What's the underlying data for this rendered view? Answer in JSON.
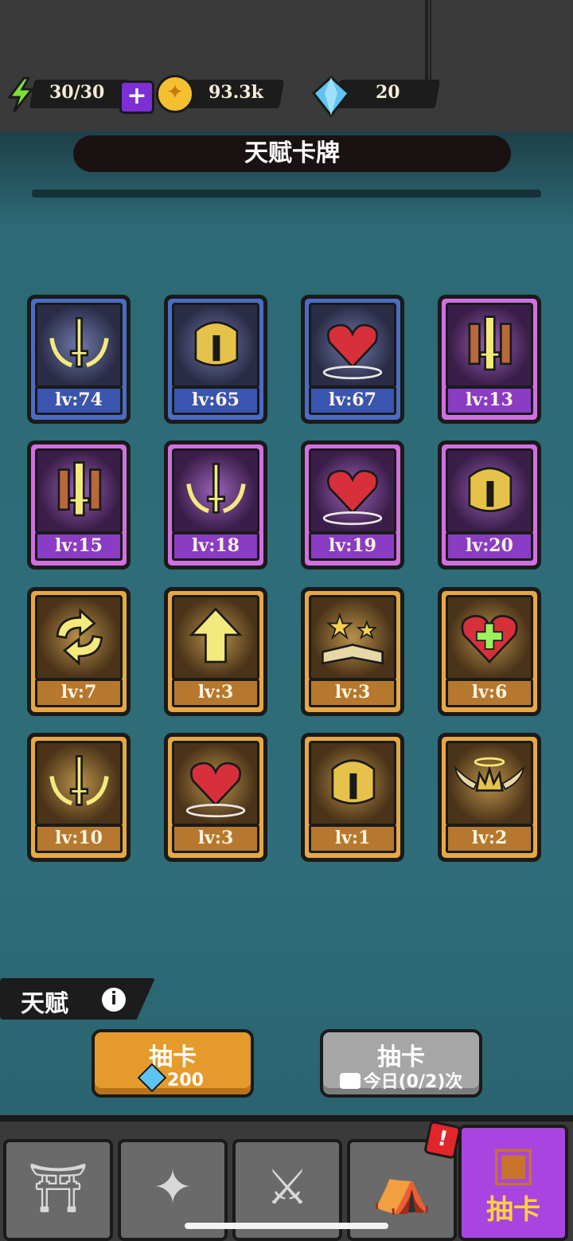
{
  "resources": {
    "energy": "30/30",
    "coins": "93.3k",
    "gems": "20"
  },
  "header": {
    "title": "天赋卡牌"
  },
  "cards": [
    {
      "level": "lv:74",
      "rarity": "blue",
      "icon": "sword-wreath-icon"
    },
    {
      "level": "lv:65",
      "rarity": "blue",
      "icon": "golden-helmet-icon"
    },
    {
      "level": "lv:67",
      "rarity": "blue",
      "icon": "heart-icon"
    },
    {
      "level": "lv:13",
      "rarity": "purple",
      "icon": "triple-sword-icon"
    },
    {
      "level": "lv:15",
      "rarity": "purple",
      "icon": "triple-sword-icon"
    },
    {
      "level": "lv:18",
      "rarity": "purple",
      "icon": "sword-wreath-icon"
    },
    {
      "level": "lv:19",
      "rarity": "purple",
      "icon": "heart-icon"
    },
    {
      "level": "lv:20",
      "rarity": "purple",
      "icon": "golden-helmet-icon"
    },
    {
      "level": "lv:7",
      "rarity": "gold",
      "icon": "cycle-arrows-icon"
    },
    {
      "level": "lv:3",
      "rarity": "gold",
      "icon": "up-arrow-icon"
    },
    {
      "level": "lv:3",
      "rarity": "gold",
      "icon": "magic-book-icon"
    },
    {
      "level": "lv:6",
      "rarity": "gold",
      "icon": "healing-heart-icon"
    },
    {
      "level": "lv:10",
      "rarity": "gold",
      "icon": "sword-wreath-icon"
    },
    {
      "level": "lv:3",
      "rarity": "gold",
      "icon": "heart-icon"
    },
    {
      "level": "lv:1",
      "rarity": "gold",
      "icon": "golden-helmet-icon"
    },
    {
      "level": "lv:2",
      "rarity": "gold",
      "icon": "winged-crown-icon"
    }
  ],
  "talent_tab": {
    "label": "天赋"
  },
  "draw_buttons": {
    "gem_draw": {
      "title": "抽卡",
      "cost": "200"
    },
    "ad_draw": {
      "title": "抽卡",
      "sub": "今日(0/2)次"
    }
  },
  "nav": {
    "active_label": "抽卡",
    "badge": "!"
  }
}
